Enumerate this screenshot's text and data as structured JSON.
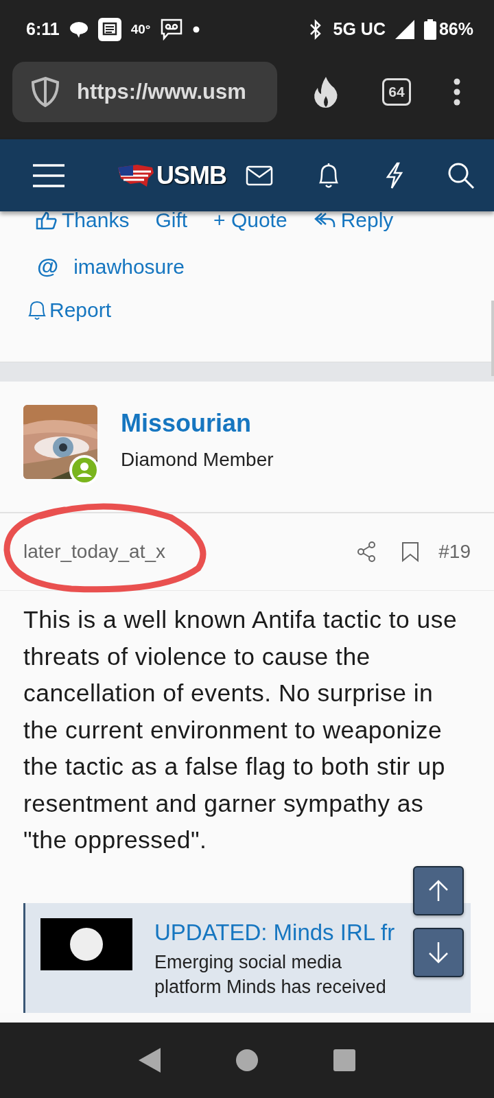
{
  "status_bar": {
    "time": "6:11",
    "temperature": "40°",
    "network": "5G UC",
    "battery": "86%"
  },
  "browser": {
    "url": "https://www.usm",
    "tab_count": "64"
  },
  "site_nav": {
    "logo": "USMB"
  },
  "previous_post": {
    "actions": [
      "Thanks",
      "Gift",
      "+ Quote",
      "Reply"
    ],
    "mention_symbol": "@",
    "mention": "imawhosure",
    "report": "Report"
  },
  "post": {
    "author": "Missourian",
    "rank": "Diamond Member",
    "online": true,
    "time": "later_today_at_x",
    "number": "#19",
    "body": "This is a well known Antifa tactic to use threats of violence to cause the cancellation of events. No surprise in the current environment to weaponize the tactic as a false flag to both stir up resentment and garner sympathy as \"the oppressed\".",
    "embed": {
      "title": "UPDATED: Minds IRL fr",
      "description": "Emerging social media platform Minds has received"
    }
  }
}
